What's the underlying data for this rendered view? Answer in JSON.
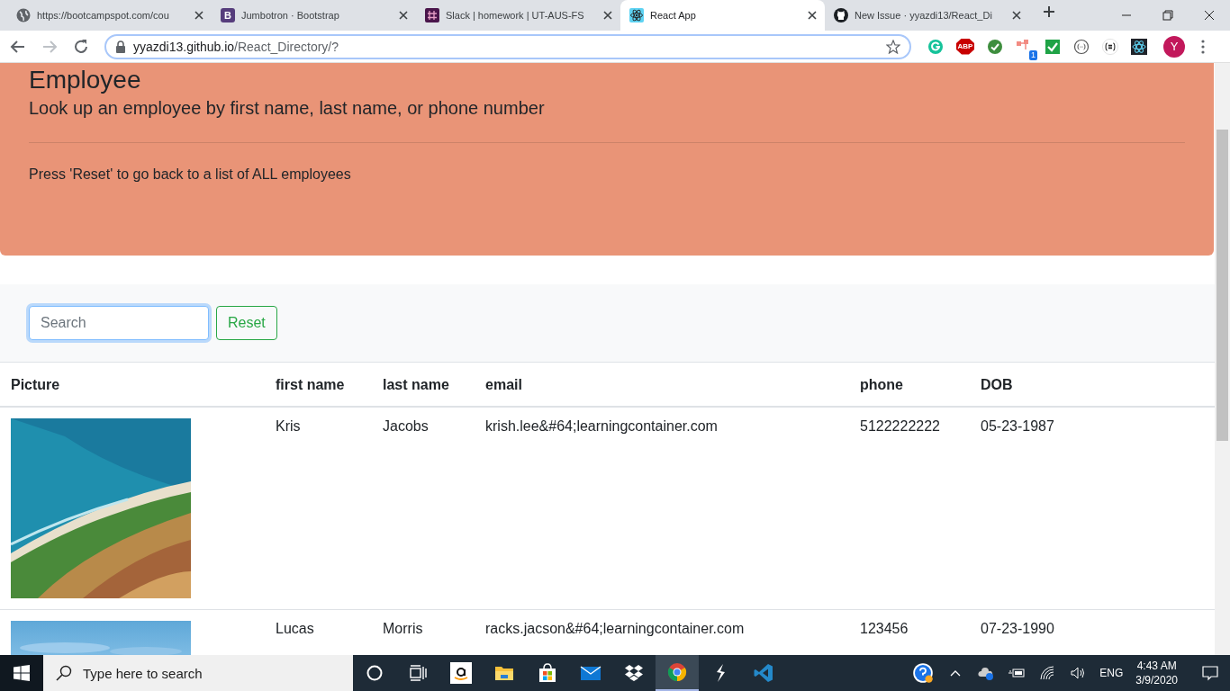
{
  "browser": {
    "tabs": [
      {
        "title": "https://bootcampspot.com/cou",
        "selected": false
      },
      {
        "title": "Jumbotron · Bootstrap",
        "icon_text": "B",
        "selected": false
      },
      {
        "title": "Slack | homework | UT-AUS-FS",
        "selected": false
      },
      {
        "title": "React App",
        "selected": true
      },
      {
        "title": "New Issue · yyazdi13/React_Di",
        "selected": false
      }
    ],
    "address": {
      "host": "yyazdi13.github.io",
      "path": "/React_Directory/?"
    },
    "extensions": [
      {
        "kind": "grammarly"
      },
      {
        "kind": "abp",
        "label": "ABP"
      },
      {
        "kind": "check"
      },
      {
        "kind": "flow",
        "badge": "1"
      },
      {
        "kind": "task"
      },
      {
        "kind": "dots"
      },
      {
        "kind": "json"
      },
      {
        "kind": "react"
      }
    ],
    "profile": "Y"
  },
  "jumbotron": {
    "title": "Employee",
    "lead": "Look up an employee by first name, last name, or phone number",
    "note": "Press 'Reset' to go back to a list of ALL employees"
  },
  "search": {
    "placeholder": "Search"
  },
  "reset_button": "Reset",
  "table": {
    "columns": [
      "Picture",
      "first name",
      "last name",
      "email",
      "phone",
      "DOB"
    ],
    "rows": [
      {
        "first": "Kris",
        "last": "Jacobs",
        "email": "krish.lee&#64;learningcontainer.com",
        "phone": "5122222222",
        "dob": "05-23-1987"
      },
      {
        "first": "Lucas",
        "last": "Morris",
        "email": "racks.jacson&#64;learningcontainer.com",
        "phone": "123456",
        "dob": "07-23-1990"
      }
    ]
  },
  "taskbar": {
    "search_placeholder": "Type here to search",
    "apps": [
      {
        "kind": "cortana",
        "active": false
      },
      {
        "kind": "taskview",
        "active": false
      },
      {
        "kind": "amazon",
        "active": false
      },
      {
        "kind": "folder",
        "active": false
      },
      {
        "kind": "store",
        "active": false
      },
      {
        "kind": "mail",
        "active": false
      },
      {
        "kind": "dropbox",
        "active": false
      },
      {
        "kind": "chrome",
        "active": true
      },
      {
        "kind": "bolt",
        "active": false
      },
      {
        "kind": "vscode",
        "active": false
      }
    ],
    "language": "ENG",
    "time": "4:43 AM",
    "date": "3/9/2020"
  }
}
